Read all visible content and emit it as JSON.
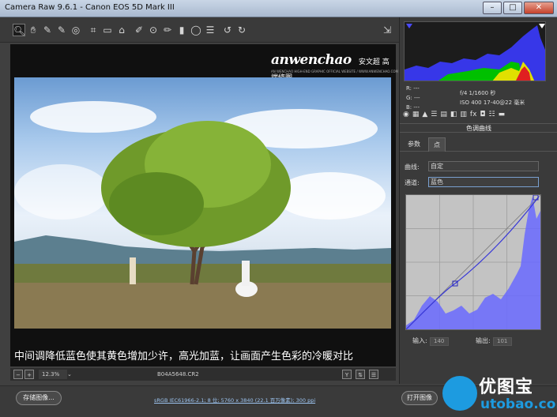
{
  "window": {
    "title": "Camera Raw 9.6.1 -  Canon EOS 5D Mark III",
    "min": "–",
    "max": "□",
    "close": "✕"
  },
  "toolbar": {
    "tools": [
      {
        "name": "zoom-tool-icon",
        "glyph": "🔍︎"
      },
      {
        "name": "hand-tool-icon",
        "glyph": "✋︎"
      },
      {
        "name": "white-balance-tool-icon",
        "glyph": "✎"
      },
      {
        "name": "color-sampler-tool-icon",
        "glyph": "✎"
      },
      {
        "name": "targeted-adjustment-tool-icon",
        "glyph": "◎"
      },
      {
        "name": "crop-tool-icon",
        "glyph": "⌗"
      },
      {
        "name": "straighten-tool-icon",
        "glyph": "▭"
      },
      {
        "name": "transform-tool-icon",
        "glyph": "⌂"
      },
      {
        "name": "spot-removal-tool-icon",
        "glyph": "✐"
      },
      {
        "name": "red-eye-tool-icon",
        "glyph": "⊙"
      },
      {
        "name": "adjustment-brush-icon",
        "glyph": "✏"
      },
      {
        "name": "graduated-filter-icon",
        "glyph": "▮"
      },
      {
        "name": "radial-filter-icon",
        "glyph": "◯"
      },
      {
        "name": "preferences-icon",
        "glyph": "☰"
      },
      {
        "name": "rotate-left-icon",
        "glyph": "↺"
      },
      {
        "name": "rotate-right-icon",
        "glyph": "↻"
      }
    ],
    "export_glyph": "⇲"
  },
  "logo": {
    "brand": "anwenchao",
    "cn": "安文超 高端修图",
    "sub": "AN WENCHAO HIGH-END GRAPHIC OFFICIAL WEBSITE / WWW.ANWENCHAO.COM"
  },
  "caption": "中间调降低蓝色使其黄色增加少许，高光加蓝，让画面产生色彩的冷暖对比",
  "status": {
    "zoom_minus": "−",
    "zoom_plus": "+",
    "zoom": "12.3%",
    "zoom_arrow": "⌄",
    "filename": "B04A5648.CR2",
    "btn_y": "Y",
    "btn_swap": "⇅",
    "btn_menu": "☰"
  },
  "bottom": {
    "save": "存储图像...",
    "workflow": "sRGB IEC61966-2.1; 8 位; 5760 x 3840 (22.1 百万像素); 300 ppi",
    "open": "打开图像"
  },
  "watermark": {
    "cn": "优图宝",
    "url": "utobao.com"
  },
  "info": {
    "r": "R:  ---",
    "g": "G:  ---",
    "b": "B:  ---",
    "exposure1": "f/4   1/1600 秒",
    "exposure2": "ISO 400   17-40@22 毫米"
  },
  "panel_icons": [
    "◉",
    "▦",
    "▲",
    "☰",
    "▤",
    "◧",
    "▥",
    "fx",
    "◘",
    "☷",
    "▬"
  ],
  "panel": {
    "title": "色调曲线",
    "tab_params": "参数",
    "tab_point": "点",
    "curve_label": "曲线:",
    "curve_value": "自定",
    "channel_label": "通道:",
    "channel_value": "蓝色",
    "input_label": "输入:",
    "input_value": "140",
    "output_label": "输出:",
    "output_value": "101"
  },
  "colors": {
    "accent": "#4a4aff",
    "histo_blue": "#5a5aff"
  }
}
